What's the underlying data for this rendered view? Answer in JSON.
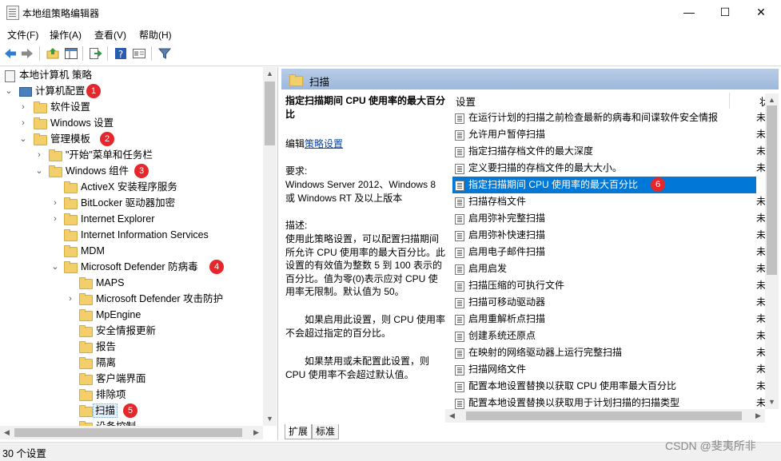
{
  "window": {
    "title": "本地组策略编辑器",
    "minimize": "—",
    "maximize": "☐",
    "close": "✕"
  },
  "menu": [
    "文件(F)",
    "操作(A)",
    "查看(V)",
    "帮助(H)"
  ],
  "tree": {
    "root": "本地计算机 策略",
    "items": [
      {
        "label": "计算机配置",
        "badge": "1"
      },
      {
        "label": "软件设置"
      },
      {
        "label": "Windows 设置"
      },
      {
        "label": "管理模板",
        "badge": "2"
      },
      {
        "label": "\"开始\"菜单和任务栏"
      },
      {
        "label": "Windows 组件",
        "badge": "3"
      },
      {
        "label": "ActiveX 安装程序服务"
      },
      {
        "label": "BitLocker 驱动器加密"
      },
      {
        "label": "Internet Explorer"
      },
      {
        "label": "Internet Information Services"
      },
      {
        "label": "MDM"
      },
      {
        "label": "Microsoft Defender 防病毒",
        "badge": "4"
      },
      {
        "label": "MAPS"
      },
      {
        "label": "Microsoft Defender 攻击防护"
      },
      {
        "label": "MpEngine"
      },
      {
        "label": "安全情报更新"
      },
      {
        "label": "报告"
      },
      {
        "label": "隔离"
      },
      {
        "label": "客户端界面"
      },
      {
        "label": "排除项"
      },
      {
        "label": "扫描",
        "badge": "5"
      },
      {
        "label": "设备控制"
      }
    ]
  },
  "right": {
    "header": "扫描",
    "description": {
      "title": "指定扫描期间 CPU 使用率的最大百分比",
      "edit_prefix": "编辑",
      "edit_link": "策略设置",
      "req_label": "要求:",
      "req_text": "Windows Server 2012、Windows 8 或 Windows RT 及以上版本",
      "desc_label": "描述:",
      "desc_text": "使用此策略设置，可以配置扫描期间所允许 CPU 使用率的最大百分比。此设置的有效值为整数 5 到 100 表示的百分比。值为零(0)表示应对 CPU 使用率无限制。默认值为 50。",
      "enabled_text": "如果启用此设置，则 CPU 使用率不会超过指定的百分比。",
      "disabled_text": "如果禁用或未配置此设置，则 CPU 使用率不会超过默认值。"
    },
    "list": {
      "col_setting": "设置",
      "col_state": "状",
      "rows": [
        {
          "label": "在运行计划的扫描之前检查最新的病毒和间谍软件安全情报",
          "state": "未"
        },
        {
          "label": "允许用户暂停扫描",
          "state": "未"
        },
        {
          "label": "指定扫描存档文件的最大深度",
          "state": "未"
        },
        {
          "label": "定义要扫描的存档文件的最大大小。",
          "state": "未"
        },
        {
          "label": "指定扫描期间 CPU 使用率的最大百分比",
          "state": "未",
          "badge": "6",
          "selected": true
        },
        {
          "label": "扫描存档文件",
          "state": "未"
        },
        {
          "label": "启用弥补完整扫描",
          "state": "未"
        },
        {
          "label": "启用弥补快速扫描",
          "state": "未"
        },
        {
          "label": "启用电子邮件扫描",
          "state": "未"
        },
        {
          "label": "启用启发",
          "state": "未"
        },
        {
          "label": "扫描压缩的可执行文件",
          "state": "未"
        },
        {
          "label": "扫描可移动驱动器",
          "state": "未"
        },
        {
          "label": "启用重解析点扫描",
          "state": "未"
        },
        {
          "label": "创建系统还原点",
          "state": "未"
        },
        {
          "label": "在映射的网络驱动器上运行完整扫描",
          "state": "未"
        },
        {
          "label": "扫描网络文件",
          "state": "未"
        },
        {
          "label": "配置本地设置替换以获取 CPU 使用率最大百分比",
          "state": "未"
        },
        {
          "label": "配置本地设置替换以获取用于计划扫描的扫描类型",
          "state": "未"
        }
      ]
    },
    "tabs": [
      "扩展",
      "标准"
    ]
  },
  "status": "30 个设置",
  "watermark": "CSDN @斐夷所非",
  "colors": {
    "selection": "#0078d7",
    "badge": "#e5262b",
    "header": "#b8cde6"
  }
}
